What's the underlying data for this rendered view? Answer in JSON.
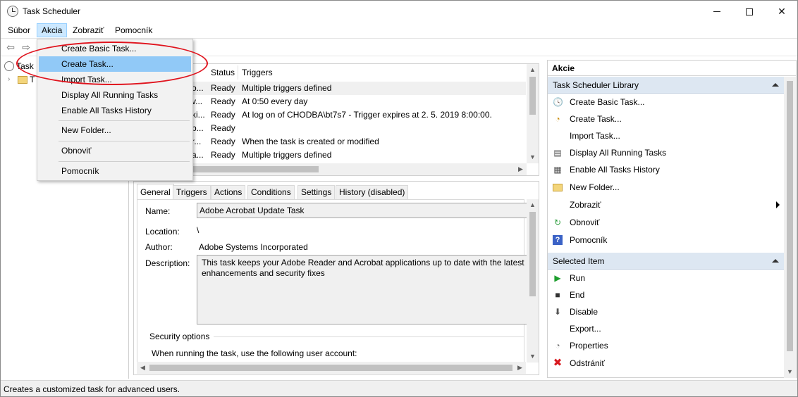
{
  "window": {
    "title": "Task Scheduler"
  },
  "menubar": {
    "items": [
      "Súbor",
      "Akcia",
      "Zobraziť",
      "Pomocník"
    ]
  },
  "akcia_menu": {
    "items": [
      "Create Basic Task...",
      "Create Task...",
      "Import Task...",
      "Display All Running Tasks",
      "Enable All Tasks History",
      "New Folder...",
      "Obnoviť",
      "Pomocník"
    ],
    "highlighted": "Create Task..."
  },
  "tree": {
    "root_label": "Task",
    "child_label": "T"
  },
  "task_list": {
    "columns": [
      "Status",
      "Triggers"
    ],
    "rows": [
      {
        "name_fragment": "o...",
        "status": "Ready",
        "triggers": "Multiple triggers defined"
      },
      {
        "name_fragment": "v...",
        "status": "Ready",
        "triggers": "At 0:50 every day"
      },
      {
        "name_fragment": "ki...",
        "status": "Ready",
        "triggers": "At log on of CHODBA\\bt7s7 - Trigger expires at 2. 5. 2019 8:00:00."
      },
      {
        "name_fragment": "p...",
        "status": "Ready",
        "triggers": ""
      },
      {
        "name_fragment": "r...",
        "status": "Ready",
        "triggers": "When the task is created or modified"
      },
      {
        "name_fragment": "a...",
        "status": "Ready",
        "triggers": "Multiple triggers defined"
      }
    ]
  },
  "details": {
    "tabs": [
      "General",
      "Triggers",
      "Actions",
      "Conditions",
      "Settings",
      "History (disabled)"
    ],
    "active_tab": "General",
    "name_label": "Name:",
    "name_value": "Adobe Acrobat Update Task",
    "location_label": "Location:",
    "location_value": "\\",
    "author_label": "Author:",
    "author_value": "Adobe Systems Incorporated",
    "description_label": "Description:",
    "description_value": "This task keeps your Adobe Reader and Acrobat applications up to date with the latest enhancements and security fixes",
    "security_heading": "Security options",
    "security_text": "When running the task, use the following user account:"
  },
  "actions_pane": {
    "header": "Akcie",
    "library_section": "Task Scheduler Library",
    "library_items": [
      {
        "label": "Create Basic Task...",
        "icon": "clock-wizard-icon"
      },
      {
        "label": "Create Task...",
        "icon": "task-icon"
      },
      {
        "label": "Import Task...",
        "icon": ""
      },
      {
        "label": "Display All Running Tasks",
        "icon": "list-icon"
      },
      {
        "label": "Enable All Tasks History",
        "icon": "history-icon"
      },
      {
        "label": "New Folder...",
        "icon": "folder-icon"
      },
      {
        "label": "Zobraziť",
        "icon": ""
      },
      {
        "label": "Obnoviť",
        "icon": "refresh-icon"
      },
      {
        "label": "Pomocník",
        "icon": "help-icon"
      }
    ],
    "selected_section": "Selected Item",
    "selected_items": [
      {
        "label": "Run",
        "icon": "run-icon"
      },
      {
        "label": "End",
        "icon": "stop-icon"
      },
      {
        "label": "Disable",
        "icon": "disable-icon"
      },
      {
        "label": "Export...",
        "icon": ""
      },
      {
        "label": "Properties",
        "icon": "properties-icon"
      },
      {
        "label": "Odstrániť",
        "icon": "delete-icon"
      }
    ]
  },
  "statusbar": {
    "text": "Creates a customized task for advanced users."
  },
  "colors": {
    "menu_highlight": "#91c9f7",
    "section_bg": "#dde7f2",
    "annotation": "#e0141e"
  }
}
